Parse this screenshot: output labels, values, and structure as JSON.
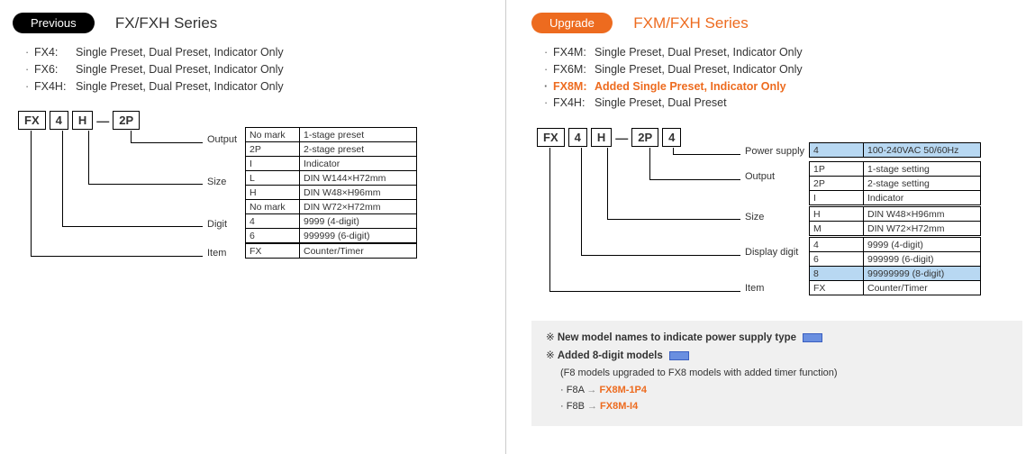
{
  "left": {
    "badge": "Previous",
    "title": "FX/FXH Series",
    "bullets": [
      {
        "k": "FX4:",
        "v": "Single Preset, Dual Preset, Indicator Only"
      },
      {
        "k": "FX6:",
        "v": "Single Preset, Dual Preset, Indicator Only"
      },
      {
        "k": "FX4H:",
        "v": "Single Preset, Dual Preset, Indicator Only"
      }
    ],
    "chain": [
      "FX",
      "4",
      "H",
      "—",
      "2P"
    ],
    "labels": {
      "output": "Output",
      "size": "Size",
      "digit": "Digit",
      "item": "Item"
    },
    "t_output": [
      [
        "No mark",
        "1-stage preset"
      ],
      [
        "2P",
        "2-stage preset"
      ],
      [
        "I",
        "Indicator"
      ]
    ],
    "t_size": [
      [
        "L",
        "DIN W144×H72mm"
      ],
      [
        "H",
        "DIN W48×H96mm"
      ],
      [
        "No mark",
        "DIN W72×H72mm"
      ]
    ],
    "t_digit": [
      [
        "4",
        "9999 (4-digit)"
      ],
      [
        "6",
        "999999 (6-digit)"
      ]
    ],
    "t_item": [
      [
        "FX",
        "Counter/Timer"
      ]
    ]
  },
  "right": {
    "badge": "Upgrade",
    "title": "FXM/FXH Series",
    "bullets": [
      {
        "k": "FX4M:",
        "v": "Single Preset, Dual Preset, Indicator Only",
        "hl": false
      },
      {
        "k": "FX6M:",
        "v": "Single Preset, Dual Preset, Indicator Only",
        "hl": false
      },
      {
        "k": "FX8M:",
        "v": "Added Single Preset, Indicator Only",
        "hl": true
      },
      {
        "k": "FX4H:",
        "v": "Single Preset, Dual Preset",
        "hl": false
      }
    ],
    "chain": [
      "FX",
      "4",
      "H",
      "—",
      "2P",
      "4"
    ],
    "labels": {
      "power": "Power supply",
      "output": "Output",
      "size": "Size",
      "digit": "Display digit",
      "item": "Item"
    },
    "t_power": [
      [
        "4",
        "100-240VAC 50/60Hz"
      ]
    ],
    "t_output": [
      [
        "1P",
        "1-stage setting"
      ],
      [
        "2P",
        "2-stage setting"
      ],
      [
        "I",
        "Indicator"
      ]
    ],
    "t_size": [
      [
        "H",
        "DIN W48×H96mm"
      ],
      [
        "M",
        "DIN W72×H72mm"
      ]
    ],
    "t_digit": [
      [
        "4",
        "9999 (4-digit)"
      ],
      [
        "6",
        "999999 (6-digit)"
      ],
      [
        "8",
        "99999999 (8-digit)"
      ]
    ],
    "t_item": [
      [
        "FX",
        "Counter/Timer"
      ]
    ],
    "highlight_rows": {
      "power": [
        0
      ],
      "digit": [
        2
      ]
    }
  },
  "notes": {
    "n1": "New model names to indicate power supply type",
    "n2": "Added 8-digit models",
    "n2sub": "(F8 models upgraded to FX8 models with added timer function)",
    "map": [
      {
        "from": "F8A",
        "to": "FX8M-1P4"
      },
      {
        "from": "F8B",
        "to": "FX8M-I4"
      }
    ]
  },
  "glyphs": {
    "bullet": "·",
    "ast": "※",
    "arrow": "→"
  }
}
